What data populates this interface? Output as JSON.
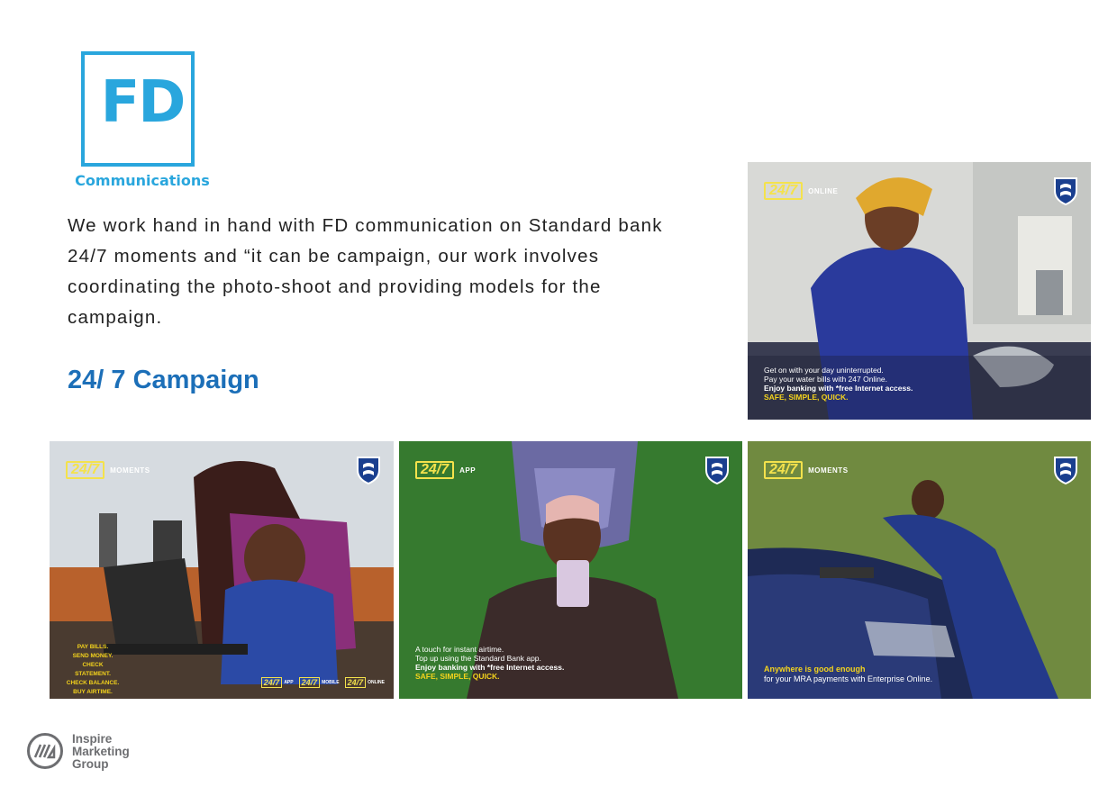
{
  "logo": {
    "letters": "FD",
    "subtitle": "Communications"
  },
  "intro": "We work hand in hand with FD communication on Standard bank 24/7 moments and “it can be campaign, our work involves coordinating the photo-shoot and providing models for the campaign.",
  "campaign": {
    "number": "24/ 7",
    "word": "Campaign"
  },
  "brand_color": "#29a6dd",
  "ads": {
    "online": {
      "badge": "24/7",
      "badge_label": "ONLINE",
      "lines": [
        "Get on with your day uninterrupted.",
        "Pay your water bills with 247 Online."
      ],
      "bold_line": "Enjoy banking with *free Internet access.",
      "tagline": "SAFE, SIMPLE, QUICK."
    },
    "moments1": {
      "badge": "24/7",
      "badge_label": "MOMENTS",
      "list": [
        "PAY BILLS.",
        "SEND MONEY.",
        "CHECK STATEMENT.",
        "CHECK BALANCE.",
        "BUY AIRTIME."
      ],
      "footer": [
        {
          "num": "24/7",
          "label": "APP"
        },
        {
          "num": "24/7",
          "label": "MOBILE"
        },
        {
          "num": "24/7",
          "label": "ONLINE"
        }
      ]
    },
    "app": {
      "badge": "24/7",
      "badge_label": "APP",
      "lines": [
        "A touch for instant airtime.",
        "Top up using the Standard Bank app."
      ],
      "bold_line": "Enjoy banking with *free Internet access.",
      "tagline": "SAFE, SIMPLE, QUICK."
    },
    "moments2": {
      "badge": "24/7",
      "badge_label": "MOMENTS",
      "headline": "Anywhere is good enough",
      "line": "for your MRA payments with Enterprise Online."
    }
  },
  "footer_logo": {
    "lines": [
      "Inspire",
      "Marketing",
      "Group"
    ]
  }
}
